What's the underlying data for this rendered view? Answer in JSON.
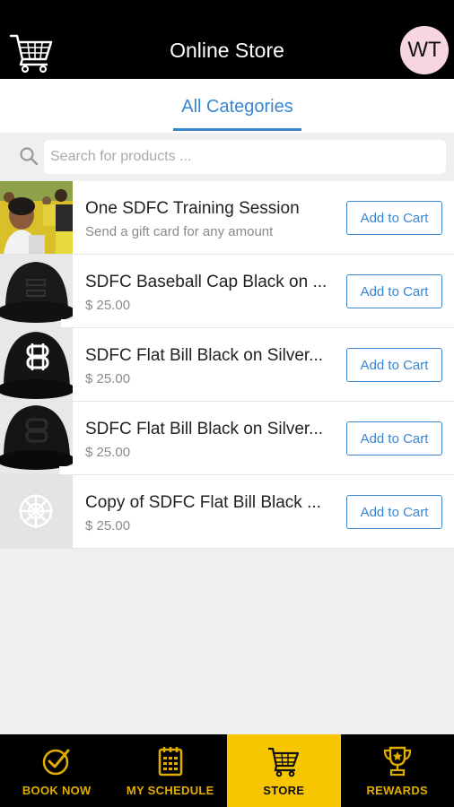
{
  "header": {
    "title": "Online Store",
    "avatar_initials": "WT",
    "cart_icon": "shopping-cart-icon"
  },
  "tabs": [
    {
      "label": "All Categories",
      "active": true
    }
  ],
  "search": {
    "placeholder": "Search for products ...",
    "value": "",
    "icon": "search-icon"
  },
  "products": [
    {
      "name": "One SDFC Training Session",
      "subtitle": "Send a gift card for any amount",
      "button": "Add to Cart",
      "image": "team-photo"
    },
    {
      "name": "SDFC Baseball Cap Black on ...",
      "subtitle": "$ 25.00",
      "button": "Add to Cart",
      "image": "black-cap"
    },
    {
      "name": "SDFC Flat Bill Black on Silver...",
      "subtitle": "$ 25.00",
      "button": "Add to Cart",
      "image": "flat-bill-cap-silver"
    },
    {
      "name": "SDFC Flat Bill Black on Silver...",
      "subtitle": "$ 25.00",
      "button": "Add to Cart",
      "image": "flat-bill-cap-black"
    },
    {
      "name": "Copy of SDFC Flat Bill Black ...",
      "subtitle": "$ 25.00",
      "button": "Add to Cart",
      "image": "placeholder-logo"
    }
  ],
  "bottom_nav": [
    {
      "label": "BOOK NOW",
      "icon": "check-circle-icon",
      "active": false
    },
    {
      "label": "MY SCHEDULE",
      "icon": "calendar-icon",
      "active": false
    },
    {
      "label": "STORE",
      "icon": "shopping-cart-icon",
      "active": true
    },
    {
      "label": "REWARDS",
      "icon": "trophy-icon",
      "active": false
    }
  ],
  "colors": {
    "header_bg": "#000000",
    "accent_blue": "#3a86d0",
    "nav_active_bg": "#f8c600",
    "nav_label": "#e0ad00"
  }
}
